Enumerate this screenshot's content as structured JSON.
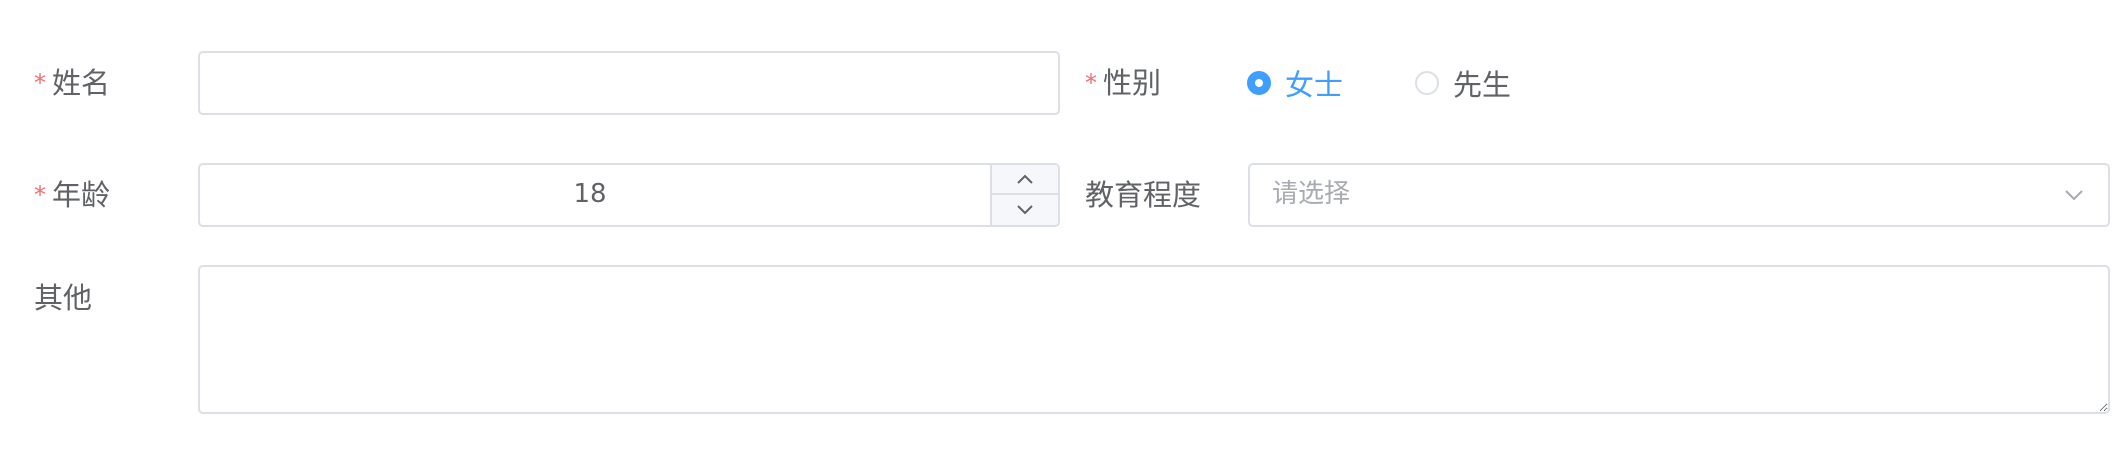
{
  "form": {
    "name": {
      "required_mark": "*",
      "label": "姓名",
      "value": ""
    },
    "gender": {
      "required_mark": "*",
      "label": "性别",
      "options": [
        {
          "label": "女士",
          "checked": true
        },
        {
          "label": "先生",
          "checked": false
        }
      ]
    },
    "age": {
      "required_mark": "*",
      "label": "年龄",
      "value": "18"
    },
    "education": {
      "label": "教育程度",
      "placeholder": "请选择"
    },
    "other": {
      "label": "其他",
      "value": ""
    }
  },
  "colors": {
    "accent": "#409eff",
    "required": "#f56c6c",
    "border": "#dcdfe6",
    "text": "#606266",
    "placeholder": "#a8abb2"
  },
  "icons": {
    "stepper_up": "chevron-up-icon",
    "stepper_down": "chevron-down-icon",
    "select": "chevron-down-icon",
    "radio_checked": "radio-checked-icon",
    "radio_unchecked": "radio-unchecked-icon"
  }
}
